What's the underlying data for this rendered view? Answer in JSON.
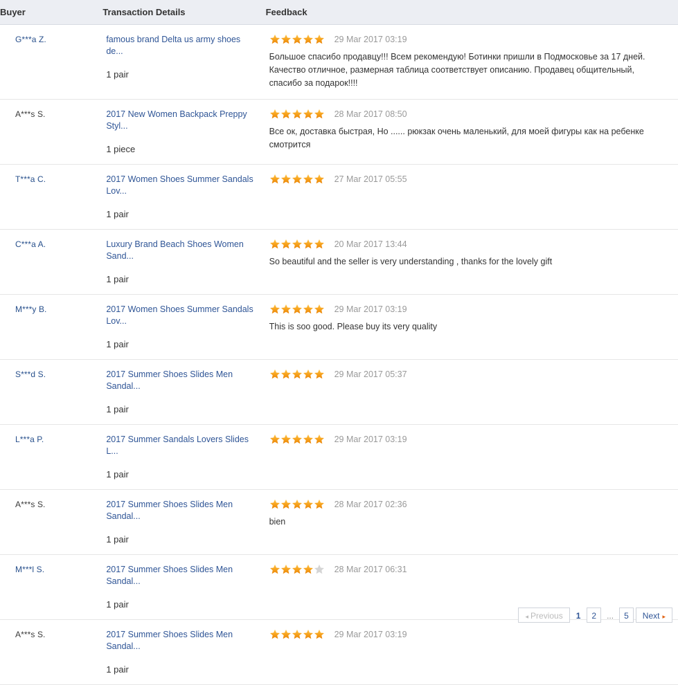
{
  "colors": {
    "header_bg": "#eceef3",
    "link": "#2f5596",
    "star_gold": "#f6a01a",
    "star_empty": "#d5d5d5",
    "date_gray": "#999999",
    "next_arrow": "#e06010"
  },
  "table": {
    "columns": [
      {
        "label": "Buyer"
      },
      {
        "label": "Transaction Details"
      },
      {
        "label": "Feedback"
      }
    ],
    "rows": [
      {
        "buyer": "G***a Z.",
        "buyer_style": "link",
        "product": "famous brand Delta us army shoes de...",
        "quantity": "1 pair",
        "rating": 5,
        "date": "29 Mar 2017 03:19",
        "comment": "Большое спасибо продавцу!!! Всем рекомендую! Ботинки пришли в Подмосковье за 17 дней. Качество отличное, размерная таблица соответствует описанию. Продавец общительный, спасибо за подарок!!!!"
      },
      {
        "buyer": "A***s S.",
        "buyer_style": "dark",
        "product": "2017 New Women Backpack Preppy Styl...",
        "quantity": "1 piece",
        "rating": 5,
        "date": "28 Mar 2017 08:50",
        "comment": "Все ок, доставка быстрая, Но ...... рюкзак очень маленький, для моей фигуры как на ребенке смотрится"
      },
      {
        "buyer": "T***a C.",
        "buyer_style": "link",
        "product": "2017 Women Shoes Summer Sandals Lov...",
        "quantity": "1 pair",
        "rating": 5,
        "date": "27 Mar 2017 05:55",
        "comment": ""
      },
      {
        "buyer": "C***a A.",
        "buyer_style": "link",
        "product": "Luxury Brand Beach Shoes Women Sand...",
        "quantity": "1 pair",
        "rating": 5,
        "date": "20 Mar 2017 13:44",
        "comment": "So beautiful and the seller is very understanding , thanks for the lovely gift"
      },
      {
        "buyer": "M***y B.",
        "buyer_style": "link",
        "product": "2017 Women Shoes Summer Sandals Lov...",
        "quantity": "1 pair",
        "rating": 5,
        "date": "29 Mar 2017 03:19",
        "comment": "This is soo good. Please buy its very quality"
      },
      {
        "buyer": "S***d S.",
        "buyer_style": "link",
        "product": "2017 Summer Shoes Slides Men Sandal...",
        "quantity": "1 pair",
        "rating": 5,
        "date": "29 Mar 2017 05:37",
        "comment": ""
      },
      {
        "buyer": "L***a P.",
        "buyer_style": "link",
        "product": "2017 Summer Sandals Lovers Slides L...",
        "quantity": "1 pair",
        "rating": 5,
        "date": "29 Mar 2017 03:19",
        "comment": ""
      },
      {
        "buyer": "A***s S.",
        "buyer_style": "dark",
        "product": "2017 Summer Shoes Slides Men Sandal...",
        "quantity": "1 pair",
        "rating": 5,
        "date": "28 Mar 2017 02:36",
        "comment": "bien"
      },
      {
        "buyer": "M***l S.",
        "buyer_style": "link",
        "product": "2017 Summer Shoes Slides Men Sandal...",
        "quantity": "1 pair",
        "rating": 4,
        "date": "28 Mar 2017 06:31",
        "comment": ""
      },
      {
        "buyer": "A***s S.",
        "buyer_style": "dark",
        "product": "2017 Summer Shoes Slides Men Sandal...",
        "quantity": "1 pair",
        "rating": 5,
        "date": "29 Mar 2017 03:19",
        "comment": ""
      }
    ]
  },
  "pagination": {
    "previous_label": "Previous",
    "next_label": "Next",
    "ellipsis": "...",
    "pages": [
      "1",
      "2",
      "5"
    ],
    "current_page": "1",
    "previous_enabled": false,
    "next_enabled": true
  }
}
